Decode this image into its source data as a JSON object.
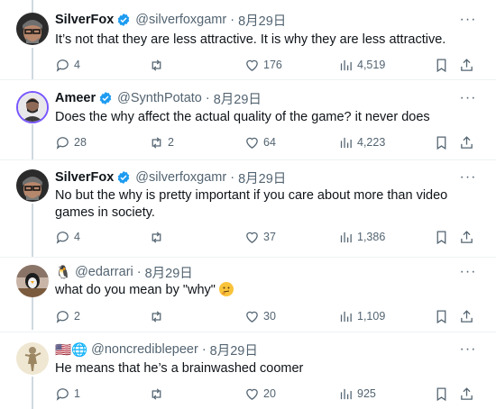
{
  "tweets": [
    {
      "name": "SilverFox",
      "verified": true,
      "handle": "@silverfoxgamr",
      "date": "8月29日",
      "text": "It’s not that they are less attractive. It is why they are less attractive.",
      "replies": "4",
      "retweets": "",
      "likes": "176",
      "views": "4,519"
    },
    {
      "name": "Ameer",
      "verified": true,
      "handle": "@SynthPotato",
      "date": "8月29日",
      "text": "Does the why affect the actual quality of the game? it never does",
      "replies": "28",
      "retweets": "2",
      "likes": "64",
      "views": "4,223"
    },
    {
      "name": "SilverFox",
      "verified": true,
      "handle": "@silverfoxgamr",
      "date": "8月29日",
      "text": "No but the why is pretty important if you care about more than video games in society.",
      "replies": "4",
      "retweets": "",
      "likes": "37",
      "views": "1,386"
    },
    {
      "name": "🐧",
      "verified": false,
      "handle": "@edarrari",
      "date": "8月29日",
      "text": "what do you mean by \"why\"",
      "replies": "2",
      "retweets": "",
      "likes": "30",
      "views": "1,109"
    },
    {
      "name": "🇺🇸🌐",
      "verified": false,
      "handle": "@noncrediblepeer",
      "date": "8月29日",
      "text": "He means that he’s a brainwashed coomer",
      "replies": "1",
      "retweets": "",
      "likes": "20",
      "views": "925"
    }
  ],
  "more_label": "···",
  "colors": {
    "verified": "#1d9bf0",
    "muted": "#536471",
    "line": "#cfd9de"
  },
  "icons": [
    "reply-icon",
    "retweet-icon",
    "like-icon",
    "views-icon",
    "bookmark-icon",
    "share-icon",
    "verified-icon",
    "more-icon",
    "thinking-face-emoji"
  ]
}
